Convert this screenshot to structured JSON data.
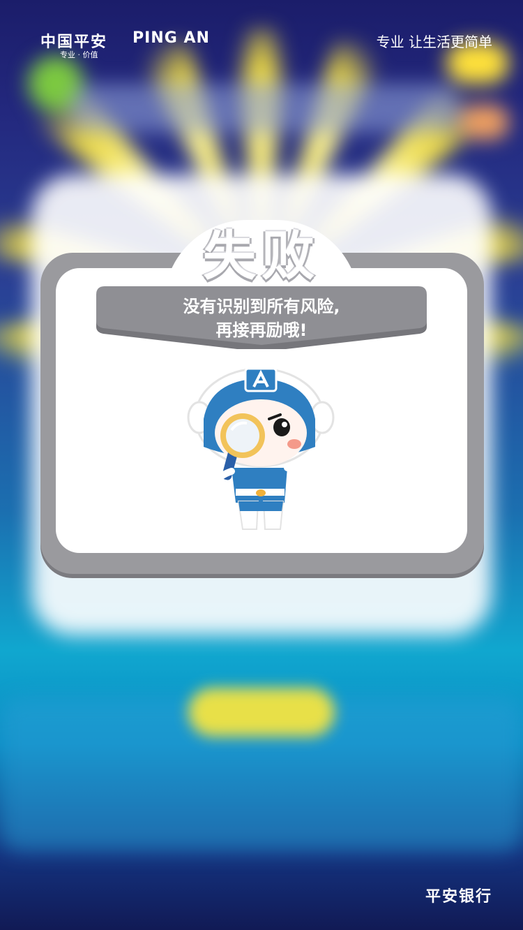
{
  "brand": {
    "logo_cn": "中国平安",
    "logo_en": "PING AN",
    "tagline": "专业 · 价值",
    "slogan": "专业 让生活更简单",
    "footer": "平安银行"
  },
  "dialog": {
    "title": "失败",
    "message_line1": "没有识别到所有风险,",
    "message_line2": "再接再励哦!",
    "mascot": "mascot-with-magnifier-icon"
  },
  "colors": {
    "bg_top": "#1b1d6a",
    "bg_mid": "#10a7cf",
    "dialog_frame": "#9a9a9e",
    "ribbon": "#8f8f94",
    "ray_yellow": "#ffe93a",
    "mascot_blue": "#2f7fc1"
  }
}
